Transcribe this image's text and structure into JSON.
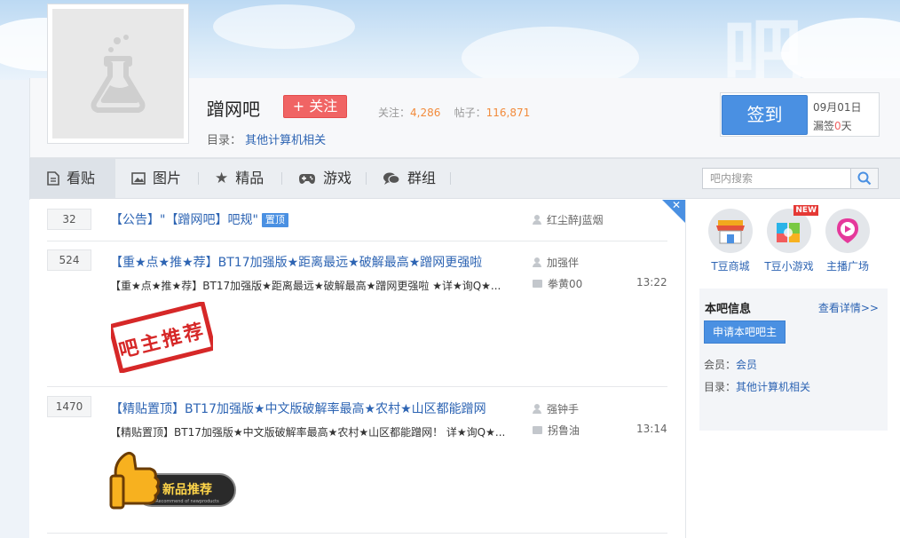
{
  "forum": {
    "name": "蹭网吧",
    "follow_label": "+ 关注",
    "stats": {
      "follow_label": "关注：",
      "follow_count": "4,286",
      "posts_label": "帖子：",
      "posts_count": "116,871"
    },
    "catalog_label": "目录：",
    "catalog_value": "其他计算机相关"
  },
  "sign": {
    "button_label": "签到",
    "date": "09月01日",
    "missed_prefix": "漏签",
    "missed_days": "0",
    "missed_suffix": "天"
  },
  "tabs": [
    {
      "label": "看贴",
      "icon": "document-icon"
    },
    {
      "label": "图片",
      "icon": "image-icon"
    },
    {
      "label": "精品",
      "icon": "star-icon"
    },
    {
      "label": "游戏",
      "icon": "gamepad-icon"
    },
    {
      "label": "群组",
      "icon": "chat-bubbles-icon"
    }
  ],
  "search": {
    "placeholder": "吧内搜索"
  },
  "threads": [
    {
      "reply_count": "32",
      "title": "【公告】\"【蹭网吧】吧规\"",
      "tag": "置顶",
      "author": "红尘醉J蓝烟"
    },
    {
      "reply_count": "524",
      "title": "【重★点★推★荐】BT17加强版★距离最远★破解最高★蹭网更强啦",
      "abstract": "【重★点★推★荐】BT17加强版★距离最远★破解最高★蹭网更强啦 ★详★询Q★...",
      "author": "加强伴",
      "last_reply": "拳黄00",
      "time": "13:22",
      "image_text": "吧主推荐"
    },
    {
      "reply_count": "1470",
      "title": "【精贴置顶】BT17加强版★中文版破解率最高★农村★山区都能蹭网",
      "abstract": "【精贴置顶】BT17加强版★中文版破解率最高★农村★山区都能蹭网！ 详★询Q★...",
      "author": "强钟手",
      "last_reply": "拐鲁油",
      "time": "13:14",
      "image_text": "新品推荐",
      "image_subtext": "Recommend of newproducts"
    }
  ],
  "apps": [
    {
      "label": "T豆商城",
      "icon": "shop-icon"
    },
    {
      "label": "T豆小游戏",
      "icon": "game-icon",
      "badge": "NEW"
    },
    {
      "label": "主播广场",
      "icon": "live-icon"
    }
  ],
  "info": {
    "title": "本吧信息",
    "more": "查看详情>>",
    "apply_label": "申请本吧吧主",
    "member_label": "会员：",
    "member_value": "会员",
    "catalog_label": "目录：",
    "catalog_value": "其他计算机相关"
  },
  "bg_char": "吧"
}
